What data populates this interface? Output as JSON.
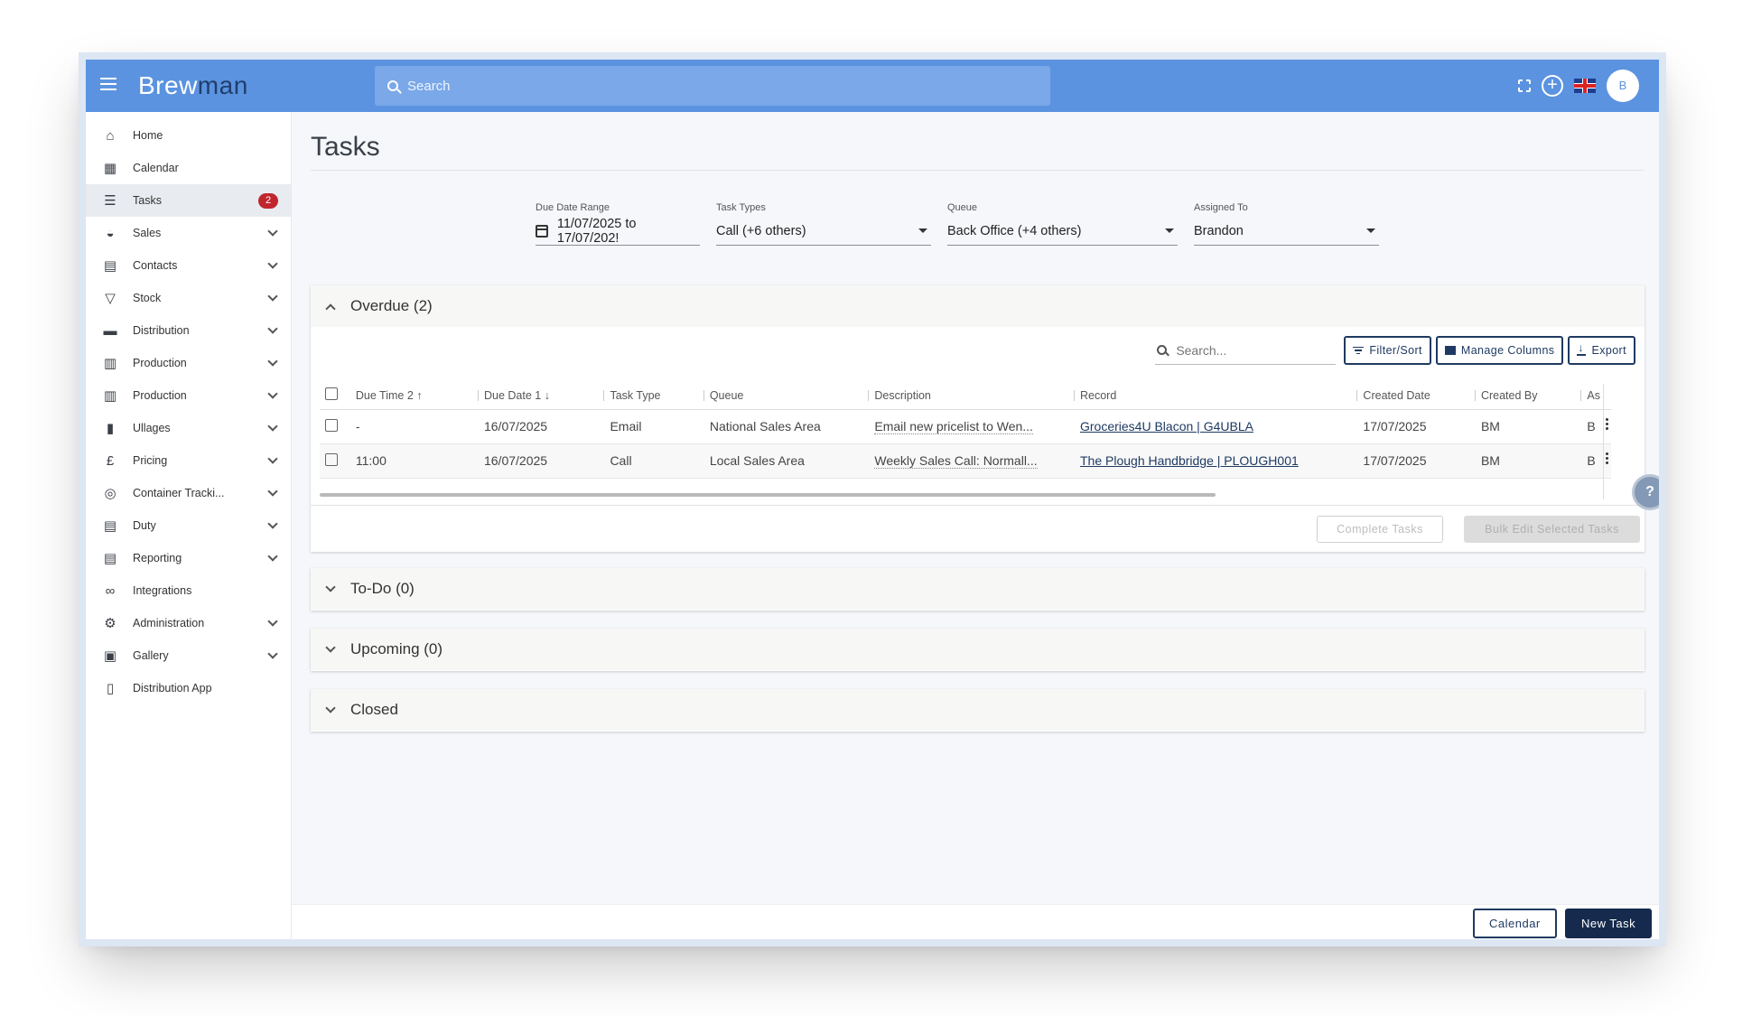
{
  "topbar": {
    "logo_brew": "Brew",
    "logo_man": "man",
    "search_placeholder": "Search",
    "avatar_initial": "B"
  },
  "sidebar": {
    "items": [
      {
        "label": "Home",
        "icon": "home-icon",
        "chevron": false
      },
      {
        "label": "Calendar",
        "icon": "calendar-icon",
        "chevron": false
      },
      {
        "label": "Tasks",
        "icon": "list-icon",
        "chevron": false,
        "badge": "2",
        "active": true
      },
      {
        "label": "Sales",
        "icon": "basket-icon",
        "chevron": true
      },
      {
        "label": "Contacts",
        "icon": "contact-card-icon",
        "chevron": true
      },
      {
        "label": "Stock",
        "icon": "glass-icon",
        "chevron": true
      },
      {
        "label": "Distribution",
        "icon": "truck-icon",
        "chevron": true
      },
      {
        "label": "Production",
        "icon": "bucket-icon",
        "chevron": true
      },
      {
        "label": "Production",
        "icon": "bucket-icon",
        "chevron": true
      },
      {
        "label": "Ullages",
        "icon": "bin-icon",
        "chevron": true
      },
      {
        "label": "Pricing",
        "icon": "pound-icon",
        "chevron": true
      },
      {
        "label": "Container Tracki...",
        "icon": "target-icon",
        "chevron": true
      },
      {
        "label": "Duty",
        "icon": "clipboard-icon",
        "chevron": true
      },
      {
        "label": "Reporting",
        "icon": "document-icon",
        "chevron": true
      },
      {
        "label": "Integrations",
        "icon": "link-icon",
        "chevron": false
      },
      {
        "label": "Administration",
        "icon": "gear-icon",
        "chevron": true
      },
      {
        "label": "Gallery",
        "icon": "gallery-icon",
        "chevron": true
      },
      {
        "label": "Distribution App",
        "icon": "phone-icon",
        "chevron": false
      }
    ]
  },
  "page": {
    "title": "Tasks"
  },
  "filters": {
    "due_date_label": "Due Date Range",
    "due_date_value": "11/07/2025 to 17/07/202!",
    "task_types_label": "Task Types",
    "task_types_value": "Call (+6 others)",
    "queue_label": "Queue",
    "queue_value": "Back Office (+4 others)",
    "assigned_label": "Assigned To",
    "assigned_value": "Brandon"
  },
  "overdue": {
    "title": "Overdue (2)",
    "search_placeholder": "Search...",
    "filter_sort": "Filter/Sort",
    "manage_columns": "Manage Columns",
    "export": "Export",
    "columns": [
      "Due Time 2 ↑",
      "Due Date 1 ↓",
      "Task Type",
      "Queue",
      "Description",
      "Record",
      "Created Date",
      "Created By",
      "As"
    ],
    "rows": [
      {
        "due_time": "-",
        "due_date": "16/07/2025",
        "task_type": "Email",
        "queue": "National Sales Area",
        "description": "Email new pricelist to Wen...",
        "record": "Groceries4U Blacon | G4UBLA",
        "created_date": "17/07/2025",
        "created_by": "BM",
        "assigned": "B"
      },
      {
        "due_time": "11:00",
        "due_date": "16/07/2025",
        "task_type": "Call",
        "queue": "Local Sales Area",
        "description": "Weekly Sales Call: Normall...",
        "record": "The Plough Handbridge | PLOUGH001",
        "created_date": "17/07/2025",
        "created_by": "BM",
        "assigned": "B"
      }
    ],
    "complete_tasks": "Complete Tasks",
    "bulk_edit": "Bulk Edit Selected Tasks"
  },
  "sections": {
    "todo": "To-Do (0)",
    "upcoming": "Upcoming (0)",
    "closed": "Closed"
  },
  "help": "?",
  "bottom": {
    "calendar": "Calendar",
    "new_task": "New Task"
  },
  "colors": {
    "topbar": "#5b93e0",
    "primary_dark": "#1f3a62",
    "badge": "#c0262d"
  }
}
